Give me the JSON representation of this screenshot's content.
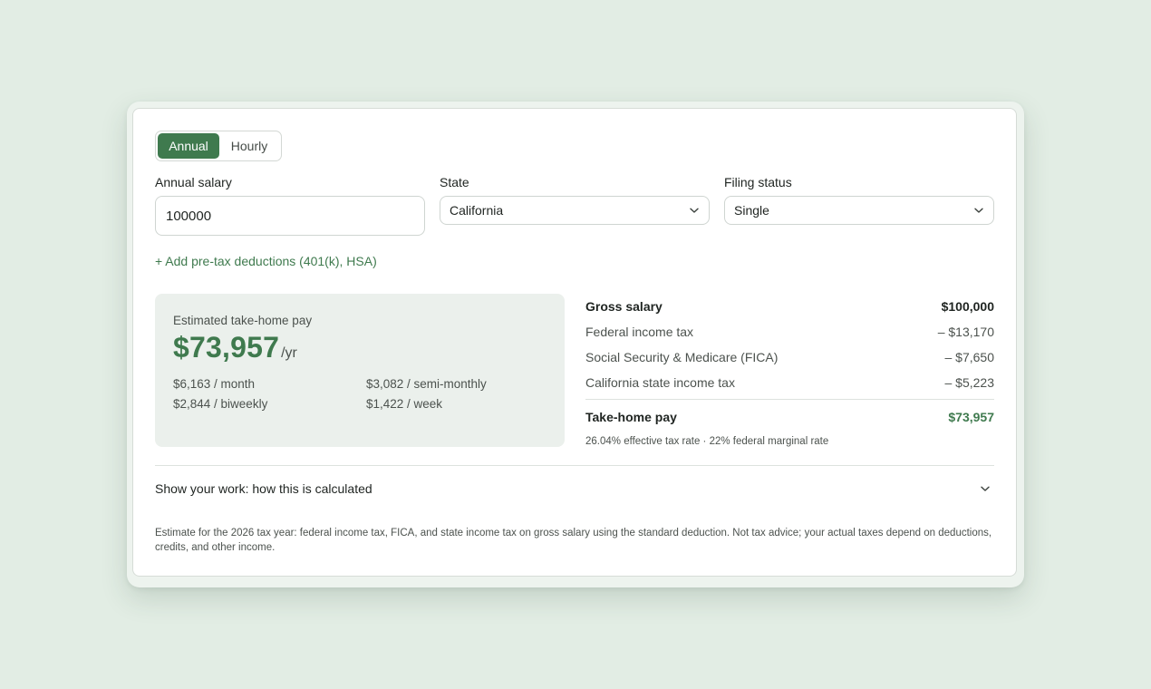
{
  "toggle": {
    "active": "Annual",
    "inactive": "Hourly"
  },
  "fields": {
    "salary_label": "Annual salary",
    "salary_value": "100000",
    "state_label": "State",
    "state_value": "California",
    "filing_label": "Filing status",
    "filing_value": "Single"
  },
  "add_deductions": "+ Add pre-tax deductions (401(k), HSA)",
  "summary": {
    "label": "Estimated take-home pay",
    "amount": "$73,957",
    "unit": "/yr",
    "month": "$6,163 / month",
    "semi_monthly": "$3,082 / semi-monthly",
    "biweekly": "$2,844 / biweekly",
    "week": "$1,422 / week"
  },
  "breakdown": {
    "gross_label": "Gross salary",
    "gross_value": "$100,000",
    "federal_label": "Federal income tax",
    "federal_value": "– $13,170",
    "fica_label": "Social Security & Medicare (FICA)",
    "fica_value": "– $7,650",
    "state_label": "California state income tax",
    "state_value": "– $5,223",
    "takehome_label": "Take-home pay",
    "takehome_value": "$73,957",
    "rate_note": "26.04% effective tax rate · 22% federal marginal rate"
  },
  "show_work": "Show your work: how this is calculated",
  "footnote": "Estimate for the 2026 tax year: federal income tax, FICA, and state income tax on gross salary using the standard deduction. Not tax advice; your actual taxes depend on deductions, credits, and other income.",
  "colors": {
    "accent": "#3f7a4e",
    "background": "#e2ede4",
    "summary_bg": "#ebf0ec"
  },
  "icons": {
    "select": "chevron-down-icon",
    "expand": "chevron-down-icon"
  }
}
